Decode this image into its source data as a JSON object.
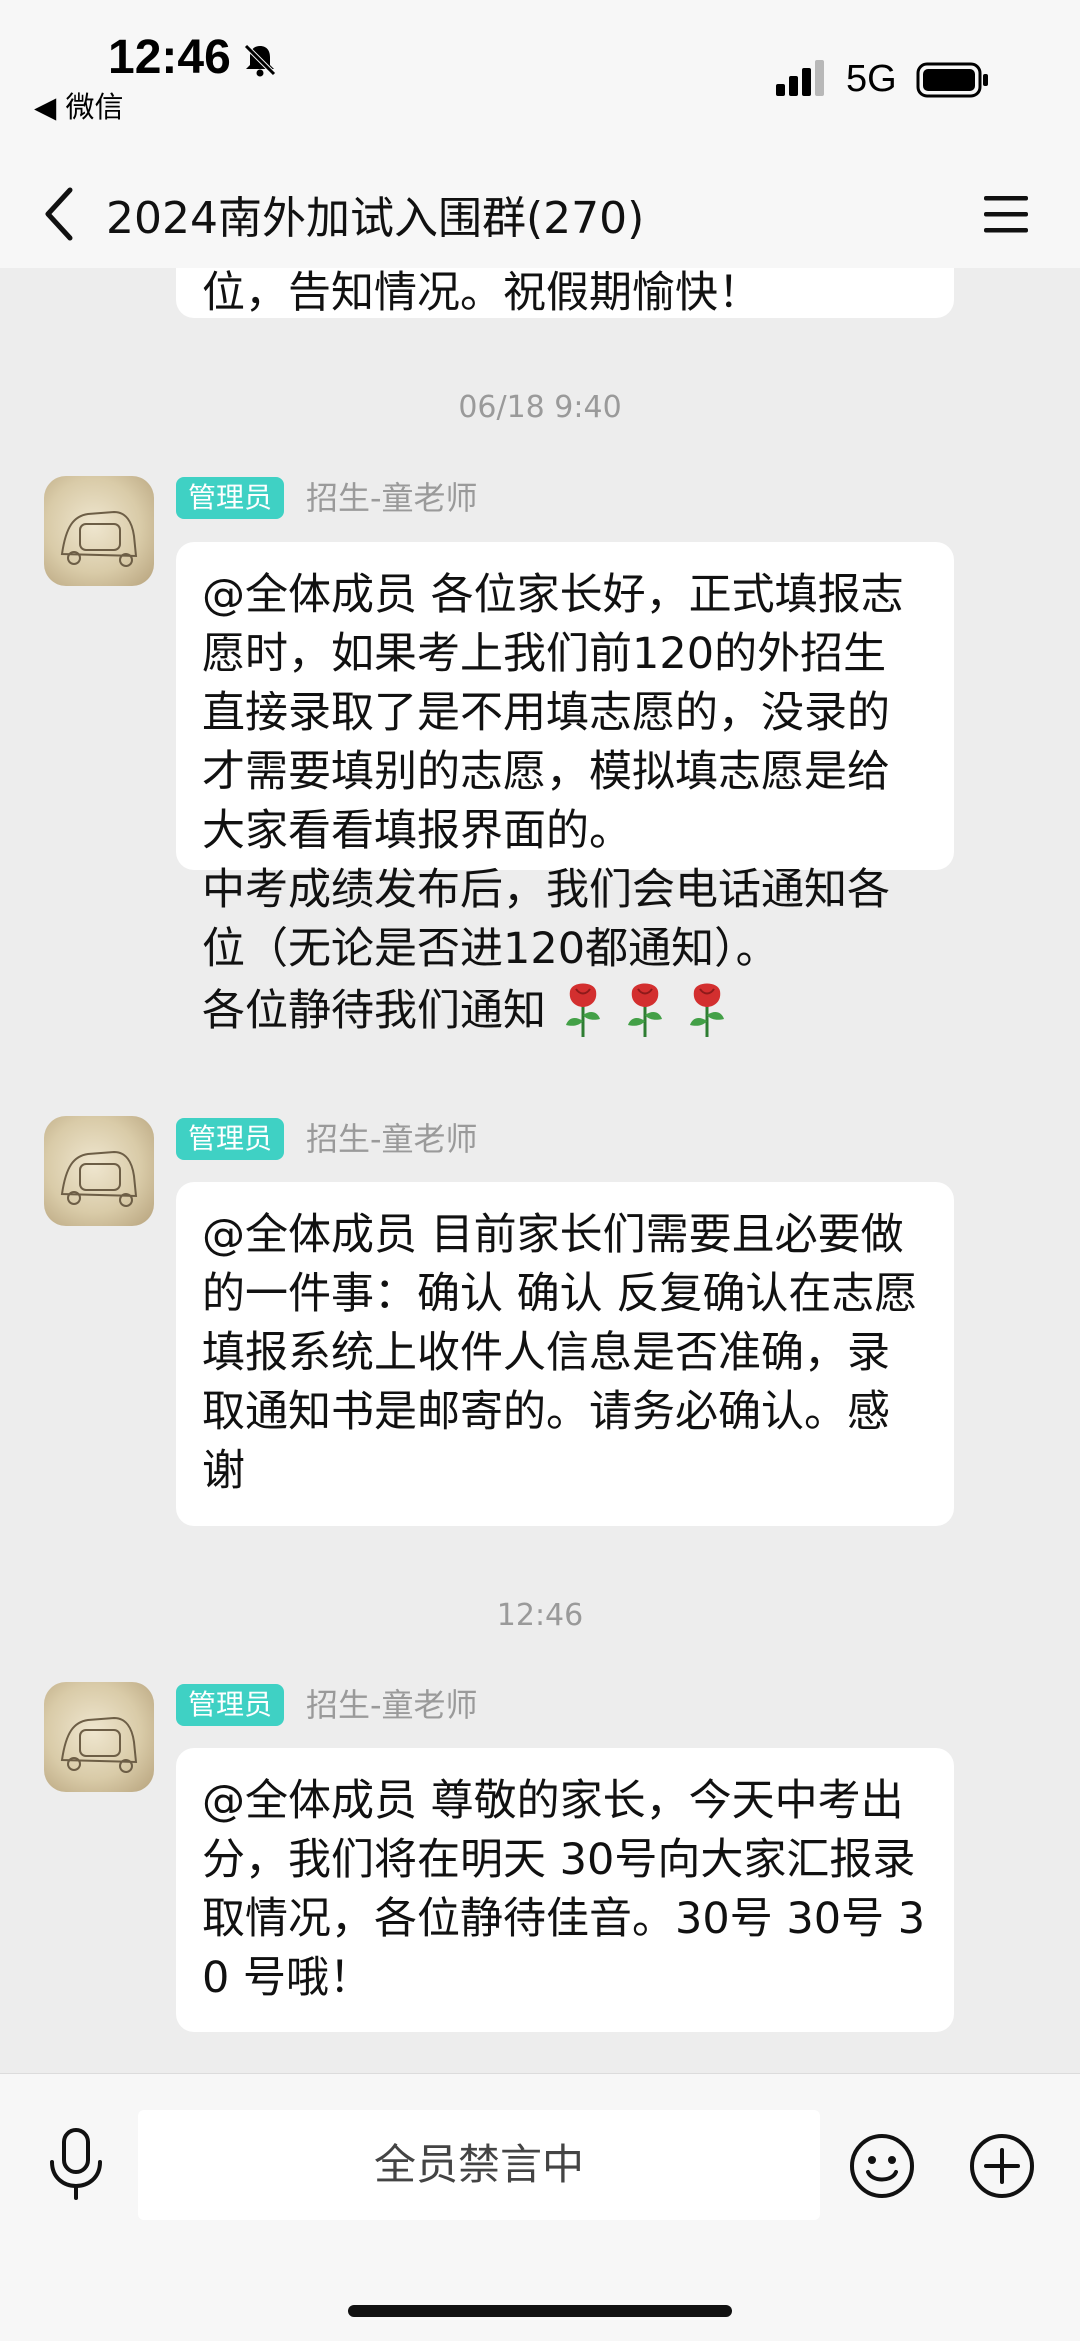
{
  "status_bar": {
    "time": "12:46",
    "back_app": "◀ 微信",
    "network": "5G",
    "icons": [
      "bell-muted-icon",
      "signal-icon",
      "battery-icon"
    ]
  },
  "nav": {
    "title": "2024南外加试入围群(270)",
    "icons": [
      "back-chevron-icon",
      "menu-icon"
    ]
  },
  "chat": {
    "previous_partial": "位，告知情况。祝假期愉快！",
    "messages": [
      {
        "timestamp": "06/18 9:40",
        "role": "管理员",
        "sender": "招生-童老师",
        "text": "@全体成员 各位家长好，正式填报志愿时，如果考上我们前120的外招生直接录取了是不用填志愿的，没录的才需要填别的志愿，模拟填志愿是给大家看看填报界面的。\n中考成绩发布后，我们会电话通知各位（无论是否进120都通知）。\n各位静待我们通知",
        "emoji": "rose-icon"
      },
      {
        "role": "管理员",
        "sender": "招生-童老师",
        "text": "@全体成员 目前家长们需要且必要做的一件事：确认 确认 反复确认在志愿填报系统上收件人信息是否准确，录取通知书是邮寄的。请务必确认。感谢"
      },
      {
        "timestamp": "12:46",
        "role": "管理员",
        "sender": "招生-童老师",
        "text": "@全体成员 尊敬的家长，今天中考出分，我们将在明天 30号向大家汇报录取情况，各位静待佳音。30号 30号 30 号哦！"
      }
    ]
  },
  "input_bar": {
    "muted_text": "全员禁言中",
    "icons": [
      "voice-icon",
      "emoji-icon",
      "plus-icon"
    ]
  },
  "colors": {
    "background": "#ededed",
    "bar": "#f7f7f7",
    "badge": "#3fd1c4",
    "bubble": "#ffffff",
    "muted_text": "#9a9a9a"
  }
}
